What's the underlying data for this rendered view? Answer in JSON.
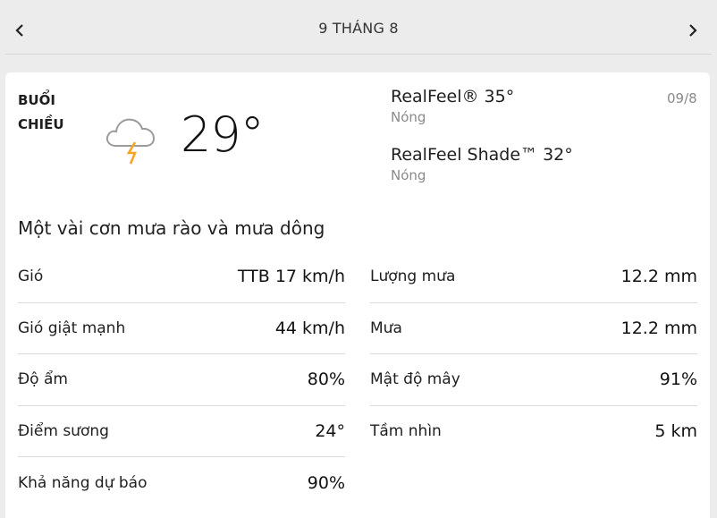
{
  "header": {
    "date": "9 THÁNG 8"
  },
  "current": {
    "period": "BUỔI CHIỀU",
    "temperature": "29°",
    "realfeel": "RealFeel® 35°",
    "realfeel_desc": "Nóng",
    "realfeel_shade": "RealFeel Shade™ 32°",
    "realfeel_shade_desc": "Nóng",
    "date": "09/8",
    "icon": "thunderstorm-cloud-icon",
    "phrase": "Một vài cơn mưa rào và mưa dông"
  },
  "details_left": [
    {
      "label": "Gió",
      "value": "TTB 17 km/h"
    },
    {
      "label": "Gió giật mạnh",
      "value": "44 km/h"
    },
    {
      "label": "Độ ẩm",
      "value": "80%"
    },
    {
      "label": "Điểm sương",
      "value": "24°"
    },
    {
      "label": "Khả năng dự báo",
      "value": "90%"
    }
  ],
  "details_right": [
    {
      "label": "Lượng mưa",
      "value": "12.2 mm"
    },
    {
      "label": "Mưa",
      "value": "12.2 mm"
    },
    {
      "label": "Mật độ mây",
      "value": "91%"
    },
    {
      "label": "Tầm nhìn",
      "value": "5 km"
    }
  ],
  "colors": {
    "lightning": "#f5a623",
    "cloud_outline": "#9b9b9b"
  }
}
